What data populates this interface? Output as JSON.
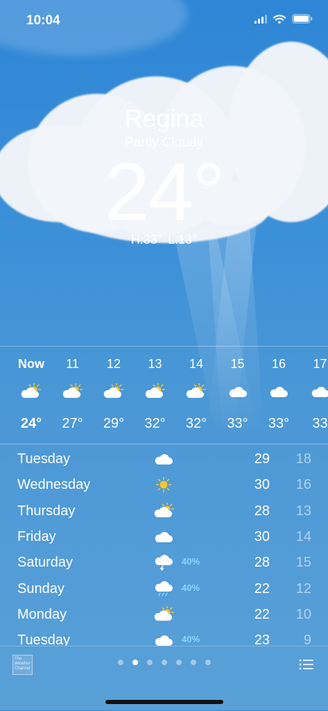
{
  "status": {
    "time": "10:04"
  },
  "location": {
    "city": "Regina",
    "condition": "Partly Cloudy",
    "temperature": "24°",
    "high": "H:33°",
    "low": "L:13°"
  },
  "hourly": [
    {
      "label": "Now",
      "icon": "partly-sunny",
      "temp": "24°"
    },
    {
      "label": "11",
      "icon": "partly-sunny",
      "temp": "27°"
    },
    {
      "label": "12",
      "icon": "partly-sunny",
      "temp": "29°"
    },
    {
      "label": "13",
      "icon": "partly-sunny",
      "temp": "32°"
    },
    {
      "label": "14",
      "icon": "partly-sunny",
      "temp": "32°"
    },
    {
      "label": "15",
      "icon": "cloud",
      "temp": "33°"
    },
    {
      "label": "16",
      "icon": "cloud",
      "temp": "33°"
    },
    {
      "label": "17",
      "icon": "cloud",
      "temp": "33"
    }
  ],
  "daily": [
    {
      "day": "Tuesday",
      "icon": "cloud",
      "precip": "",
      "high": "29",
      "low": "18"
    },
    {
      "day": "Wednesday",
      "icon": "sun",
      "precip": "",
      "high": "30",
      "low": "16"
    },
    {
      "day": "Thursday",
      "icon": "partly-sunny",
      "precip": "",
      "high": "28",
      "low": "13"
    },
    {
      "day": "Friday",
      "icon": "cloud",
      "precip": "",
      "high": "30",
      "low": "14"
    },
    {
      "day": "Saturday",
      "icon": "thunderstorm",
      "precip": "40%",
      "high": "28",
      "low": "15"
    },
    {
      "day": "Sunday",
      "icon": "rain",
      "precip": "40%",
      "high": "22",
      "low": "12"
    },
    {
      "day": "Monday",
      "icon": "partly-sunny",
      "precip": "",
      "high": "22",
      "low": "10"
    },
    {
      "day": "Tuesday",
      "icon": "cloud",
      "precip": "40%",
      "high": "23",
      "low": "9"
    }
  ],
  "footer": {
    "provider": "The Weather Channel",
    "page_count": 7,
    "active_page_index": 1
  },
  "colors": {
    "sun": "#f7c531",
    "precip": "#8fd4ff",
    "sky": "#3a8fd8"
  }
}
